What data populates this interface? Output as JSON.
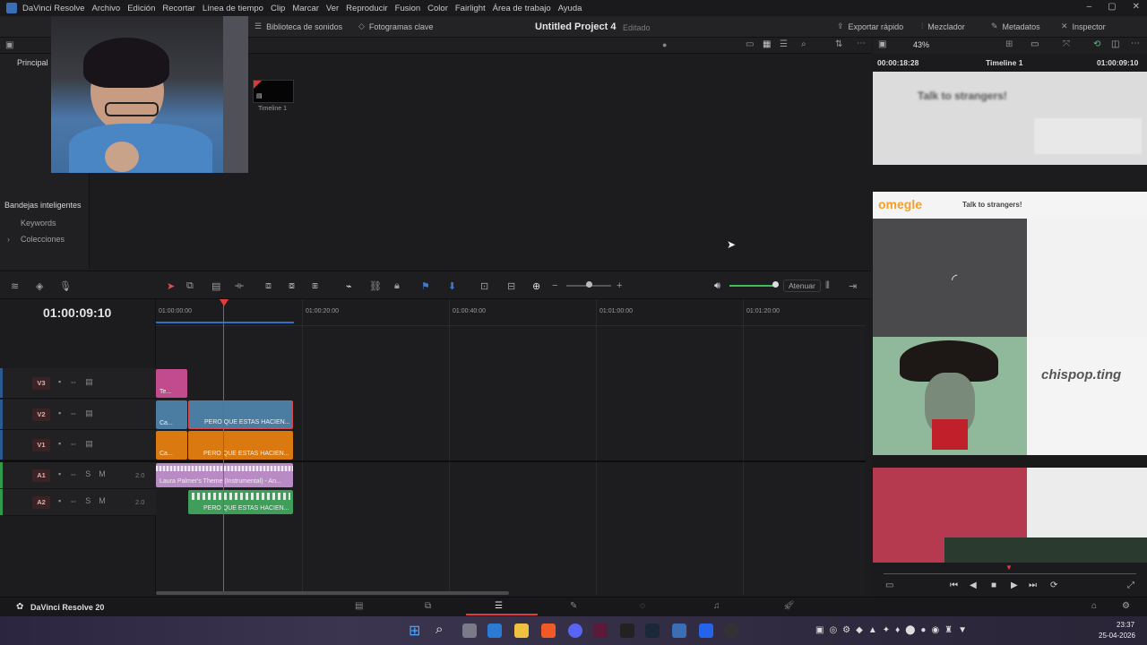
{
  "menubar": {
    "app_name": "DaVinci Resolve",
    "items": [
      "Archivo",
      "Edición",
      "Recortar",
      "Línea de tiempo",
      "Clip",
      "Marcar",
      "Ver",
      "Reproducir",
      "Fusion",
      "Color",
      "Fairlight",
      "Área de trabajo",
      "Ayuda"
    ]
  },
  "toolbar": {
    "sound_library": "Biblioteca de sonidos",
    "keyframes": "Fotogramas clave",
    "project_title": "Untitled Project 4",
    "project_status": "Editado",
    "quick_export": "Exportar rápido",
    "mixer": "Mezclador",
    "metadata": "Metadatos",
    "inspector": "Inspector"
  },
  "media": {
    "bin_label": "Principal",
    "smart_bins_title": "Bandejas inteligentes",
    "smart_bins": [
      "Keywords",
      "Colecciones"
    ],
    "thumbnail_label": "Timeline 1"
  },
  "timeline_toolbar": {
    "dim_label": "Atenuar"
  },
  "timeline": {
    "timecode": "01:00:09:10",
    "ruler": [
      "01:00:00:00",
      "01:00:20:00",
      "01:00:40:00",
      "01:01:00:00",
      "01:01:20:00"
    ],
    "tracks": [
      {
        "id": "V3",
        "type": "video"
      },
      {
        "id": "V2",
        "type": "video"
      },
      {
        "id": "V1",
        "type": "video"
      },
      {
        "id": "A1",
        "type": "audio",
        "channels": "2.0",
        "solo": "S",
        "mute": "M"
      },
      {
        "id": "A2",
        "type": "audio",
        "channels": "2.0",
        "solo": "S",
        "mute": "M"
      }
    ],
    "clips": {
      "v3": "Te...",
      "v2_a": "Ca...",
      "v2_b": "PERO QUE ESTAS HACIEN...",
      "v1_a": "Ca...",
      "v1_b": "PERO QUE ESTAS HACIEN...",
      "a1": "Laura Palmer's Theme (Instrumental) - An...",
      "a2": "PERO QUE ESTAS HACIEN..."
    }
  },
  "viewer": {
    "zoom": "43%",
    "source_tc": "00:00:18:28",
    "timeline_name": "Timeline 1",
    "record_tc": "01:00:09:10",
    "blur_text_top": "Talk to strangers!",
    "site_name": "omegle",
    "site_tagline": "Talk to strangers!",
    "overlay_text": "chispop.ting"
  },
  "pagebar": {
    "brand": "DaVinci Resolve 20"
  },
  "taskbar": {
    "time": "23:37",
    "date": "25-04-2026"
  },
  "colors": {
    "accent": "#e23b3b",
    "v1_clip": "#d9790f",
    "v2_clip": "#4b7da3",
    "v3_clip": "#c24b8e",
    "a1_clip": "#b98bc4",
    "a2_clip": "#3e9e5a"
  }
}
